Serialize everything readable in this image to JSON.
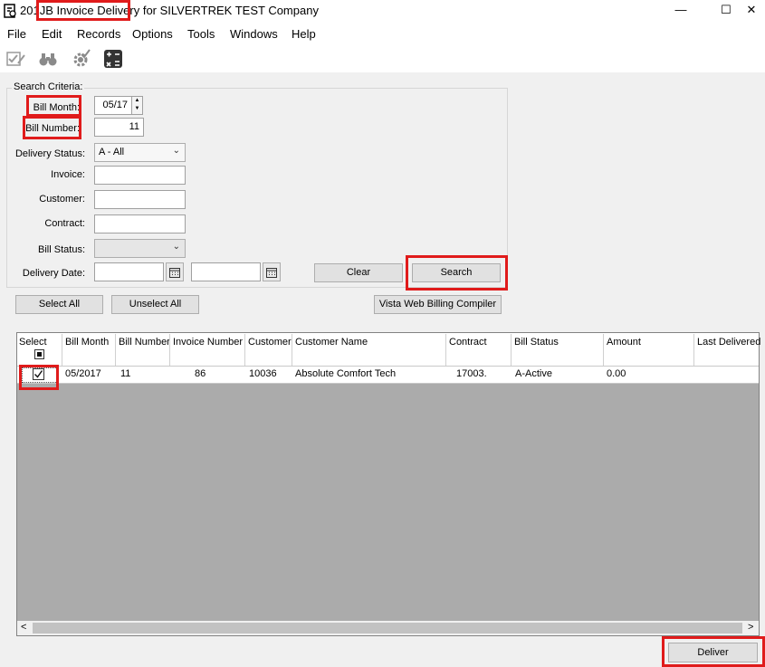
{
  "window": {
    "title": "201JB Invoice Delivery for SILVERTREK TEST Company",
    "minimize_glyph": "—",
    "maximize_glyph": "☐",
    "close_glyph": "✕"
  },
  "menu": [
    "File",
    "Edit",
    "Records",
    "Options",
    "Tools",
    "Windows",
    "Help"
  ],
  "toolbar": {
    "icons": [
      "checklist-pencil-icon",
      "binoculars-icon",
      "gear-check-icon",
      "calculator-icon"
    ]
  },
  "search": {
    "legend": "Search Criteria:",
    "bill_month_label": "Bill Month:",
    "bill_month_value": "05/17",
    "bill_number_label": "Bill Number:",
    "bill_number_value": "11",
    "delivery_status_label": "Delivery Status:",
    "delivery_status_value": "A - All",
    "invoice_label": "Invoice:",
    "invoice_value": "",
    "customer_label": "Customer:",
    "customer_value": "",
    "contract_label": "Contract:",
    "contract_value": "",
    "bill_status_label": "Bill Status:",
    "bill_status_value": "",
    "delivery_date_label": "Delivery Date:",
    "delivery_date_from": "",
    "delivery_date_to": "",
    "clear_label": "Clear",
    "search_label": "Search"
  },
  "actions": {
    "select_all": "Select All",
    "unselect_all": "Unselect All",
    "compiler": "Vista Web Billing Compiler",
    "deliver": "Deliver"
  },
  "grid": {
    "columns": [
      "Select",
      "Bill Month",
      "Bill Number",
      "Invoice Number",
      "Customer",
      "Customer Name",
      "Contract",
      "Bill Status",
      "Amount",
      "Last Delivered"
    ],
    "rows": [
      {
        "select": true,
        "bill_month": "05/2017",
        "bill_number": "11",
        "invoice_number": "86",
        "customer": "10036",
        "customer_name": "Absolute Comfort Tech",
        "contract": "17003.",
        "bill_status": "A-Active",
        "amount": "0.00",
        "last_delivered": ""
      }
    ],
    "scroll_left_glyph": "<",
    "scroll_right_glyph": ">"
  }
}
